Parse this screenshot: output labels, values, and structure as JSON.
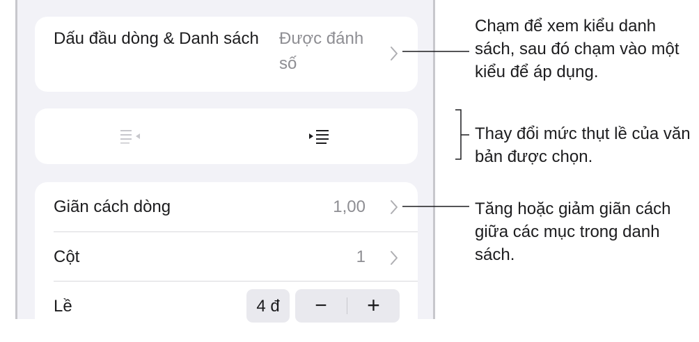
{
  "bullets_lists": {
    "label": "Dấu đầu dòng & Danh sách",
    "value": "Được đánh số"
  },
  "indent": {
    "decrease_icon": "outdent-icon",
    "increase_icon": "indent-icon"
  },
  "line_spacing": {
    "label": "Giãn cách dòng",
    "value": "1,00"
  },
  "columns": {
    "label": "Cột",
    "value": "1"
  },
  "margin": {
    "label": "Lề",
    "value": "4 đ",
    "decrease": "−",
    "increase": "+"
  },
  "callouts": {
    "list_style": "Chạm để xem kiểu danh sách, sau đó chạm vào một kiểu để áp dụng.",
    "indent": "Thay đổi mức thụt lề của văn bản được chọn.",
    "spacing": "Tăng hoặc giảm giãn cách giữa các mục trong danh sách."
  }
}
